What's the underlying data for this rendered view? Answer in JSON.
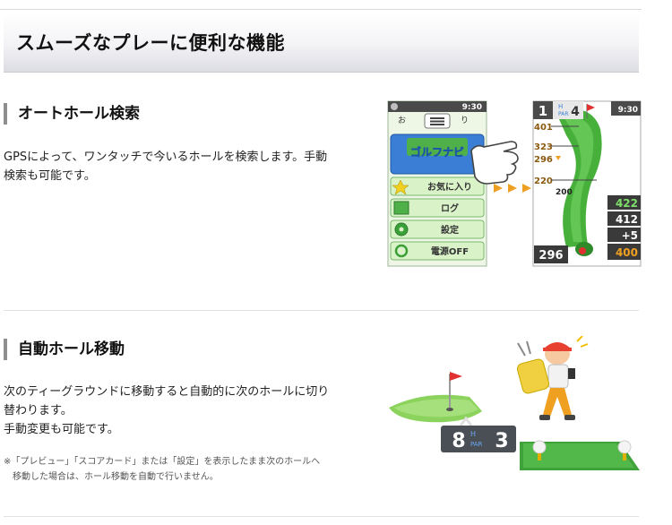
{
  "hero": {
    "title": "スムーズなプレーに便利な機能"
  },
  "section1": {
    "title": "オートホール検索",
    "body": "GPSによって、ワンタッチで今いるホールを検索します。手動検索も可能です。",
    "body_lines": [
      "GPSによって、ワンタッチで今いるホールを検索します。手動",
      "検索も可能です。"
    ],
    "menu_screen": {
      "time": "9:30",
      "title_left": "お",
      "title_right": "り",
      "items": [
        "ゴルフナビ",
        "お気に入り",
        "ログ",
        "設定",
        "電源OFF"
      ]
    },
    "course_screen": {
      "hole": "1",
      "hole_unit": "H",
      "par_label": "PAR",
      "par": "4",
      "time": "9:30",
      "distances": [
        "401",
        "323",
        "296",
        "220",
        "200"
      ],
      "scores": [
        "422",
        "412",
        "+5",
        "400"
      ],
      "bottom_left": "296"
    }
  },
  "section2": {
    "title": "自動ホール移動",
    "body_lines": [
      "次のティーグラウンドに移動すると自動的に次のホールに切り",
      "替わります。",
      "手動変更も可能です。"
    ],
    "note_lines": [
      "※「プレビュー」「スコアカード」または「設定」を表示したまま次のホールへ",
      "移動した場合は、ホール移動を自動で行いません。"
    ],
    "illustration": {
      "hole": "8",
      "hole_unit": "H",
      "par_label": "PAR",
      "par": "3"
    }
  },
  "colors": {
    "accent_gray": "#8e8e8e",
    "screen_green": "#47b03b",
    "menu_blue": "#3a7fd5",
    "orange_arrow": "#f0a020"
  }
}
